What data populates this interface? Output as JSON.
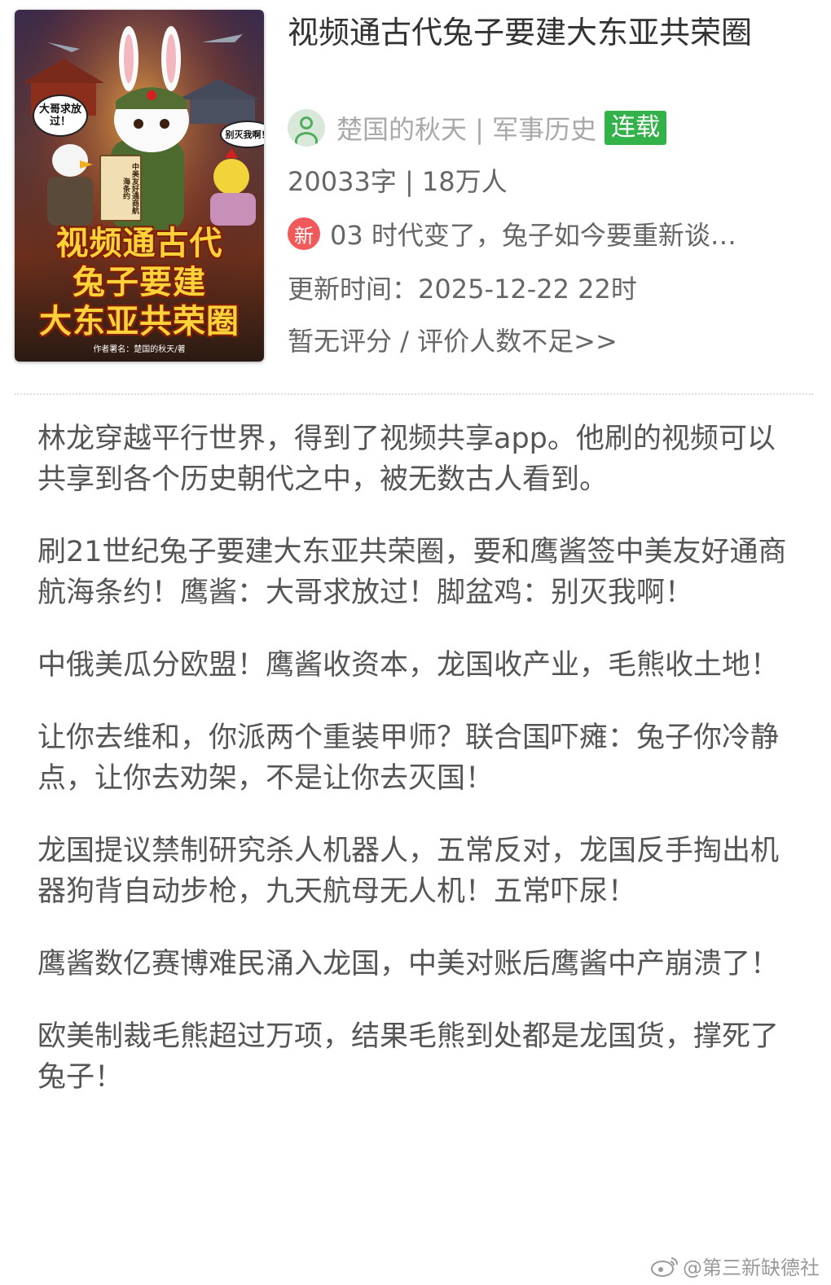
{
  "book": {
    "title": "视频通古代兔子要建大东亚共荣圈",
    "author_line": "楚国的秋天 | 军事历史",
    "status_badge": "连载",
    "stats": "20033字 | 18万人",
    "latest_icon": "新",
    "latest_chapter": "03 时代变了，兔子如今要重新谈…",
    "update_time": "更新时间：2025-12-22 22时",
    "rating": "暂无评分 / 评价人数不足>>"
  },
  "cover": {
    "bubble_left": "大哥求放过！",
    "bubble_right": "别灭我啊！",
    "scroll_text": "中美友好通商航海条约",
    "title_line1": "视频通古代",
    "title_line2": "兔子要建",
    "title_line3": "大东亚共荣圈",
    "author_note": "作者署名：楚国的秋天/著"
  },
  "synopsis": [
    "林龙穿越平行世界，得到了视频共享app。他刷的视频可以共享到各个历史朝代之中，被无数古人看到。",
    "刷21世纪兔子要建大东亚共荣圈，要和鹰酱签中美友好通商航海条约！鹰酱：大哥求放过！脚盆鸡：别灭我啊！",
    "中俄美瓜分欧盟！鹰酱收资本，龙国收产业，毛熊收土地！",
    "让你去维和，你派两个重装甲师？联合国吓瘫：兔子你冷静点，让你去劝架，不是让你去灭国！",
    "龙国提议禁制研究杀人机器人，五常反对，龙国反手掏出机器狗背自动步枪，九天航母无人机！五常吓尿！",
    "鹰酱数亿赛博难民涌入龙国，中美对账后鹰酱中产崩溃了！",
    "欧美制裁毛熊超过万项，结果毛熊到处都是龙国货，撑死了兔子！"
  ],
  "watermark": "@第三新缺德社",
  "icons": {
    "avatar": "user-avatar-icon",
    "new": "new-badge-icon",
    "watermark": "weibo-icon"
  },
  "colors": {
    "badge_green": "#33b24a",
    "new_red": "#f05a5a",
    "text": "#555555"
  }
}
